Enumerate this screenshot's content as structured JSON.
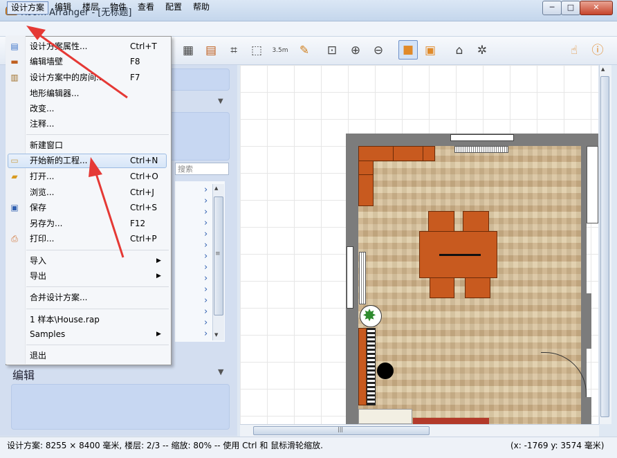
{
  "window": {
    "title": "Room Arranger - [无标题]",
    "controls": {
      "min": "─",
      "max": "□",
      "close": "✕"
    }
  },
  "menubar": [
    "设计方案",
    "编辑",
    "楼层",
    "物件",
    "查看",
    "配置",
    "帮助"
  ],
  "dropdown": {
    "groups": [
      [
        {
          "label": "设计方案属性...",
          "shortcut": "Ctrl+T",
          "icon": "project-properties-icon"
        },
        {
          "label": "编辑墙壁",
          "shortcut": "F8",
          "icon": "brick-wall-icon"
        },
        {
          "label": "设计方案中的房间...",
          "shortcut": "F7",
          "icon": "room-plan-icon"
        },
        {
          "label": "地形编辑器...",
          "shortcut": ""
        },
        {
          "label": "改变...",
          "shortcut": ""
        },
        {
          "label": "注释...",
          "shortcut": ""
        }
      ],
      [
        {
          "label": "新建窗口",
          "shortcut": ""
        },
        {
          "label": "开始新的工程...",
          "shortcut": "Ctrl+N",
          "icon": "new-project-icon"
        },
        {
          "label": "打开...",
          "shortcut": "Ctrl+O",
          "icon": "open-folder-icon"
        },
        {
          "label": "浏览...",
          "shortcut": "Ctrl+J"
        },
        {
          "label": "保存",
          "shortcut": "Ctrl+S",
          "icon": "save-disk-icon"
        },
        {
          "label": "另存为...",
          "shortcut": "F12"
        },
        {
          "label": "打印...",
          "shortcut": "Ctrl+P",
          "icon": "printer-icon"
        }
      ],
      [
        {
          "label": "导入",
          "submenu": true
        },
        {
          "label": "导出",
          "submenu": true
        }
      ],
      [
        {
          "label": "合并设计方案...",
          "shortcut": ""
        }
      ],
      [
        {
          "label": "1  样本\\House.rap",
          "shortcut": ""
        },
        {
          "label": "Samples",
          "submenu": true
        }
      ],
      [
        {
          "label": "退出",
          "shortcut": ""
        }
      ]
    ],
    "highlighted": "开始新的工程..."
  },
  "toolbar": {
    "icons": [
      "wall-edit-icon",
      "brick-icon",
      "crop-icon",
      "move-object-icon",
      "measure-icon",
      "pencil-icon",
      "zoom-fit-icon",
      "zoom-in-icon",
      "zoom-out-icon",
      "3d-box-icon",
      "boxes-icon",
      "house-icon",
      "settings-house-icon",
      "hand-icon",
      "info-icon"
    ],
    "measure_label": "3.5m",
    "pressed": "3d-box-icon"
  },
  "leftpanel": {
    "search_placeholder": "搜索",
    "edit_label": "编辑",
    "chevron": "›",
    "collapse": "▼"
  },
  "scrollbar": {
    "grip": "≡",
    "hgrip": "|||",
    "up": "▲",
    "down": "▼"
  },
  "statusbar": {
    "left": "设计方案: 8255 × 8400 毫米, 楼层: 2/3 -- 缩放: 80% -- 使用 Ctrl 和 鼠标滑轮缩放.",
    "right": "(x: -1769 y: 3574 毫米)"
  },
  "colors": {
    "accent": "#e53935",
    "furniture": "#c85a1f",
    "wall": "#7c7c7c",
    "plant": "#2e8b2e"
  }
}
